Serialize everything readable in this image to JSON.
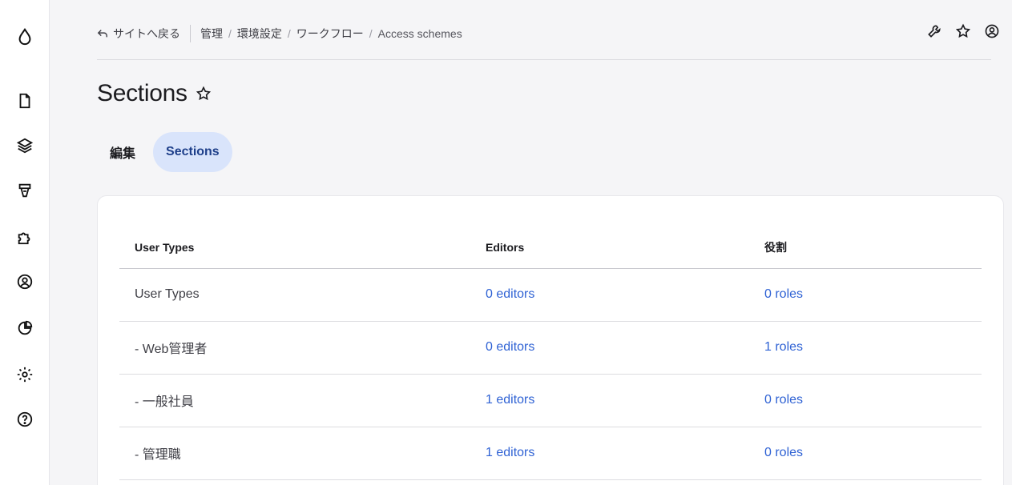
{
  "sidebar": {
    "items": [
      {
        "icon": "drop-logo-icon"
      },
      {
        "icon": "content-icon"
      },
      {
        "icon": "structure-icon"
      },
      {
        "icon": "appearance-icon"
      },
      {
        "icon": "extend-icon"
      },
      {
        "icon": "people-icon"
      },
      {
        "icon": "reports-icon"
      },
      {
        "icon": "configuration-icon"
      },
      {
        "icon": "help-icon"
      }
    ]
  },
  "topbar": {
    "back_label": "サイトへ戻る",
    "breadcrumb": [
      "管理",
      "環境設定",
      "ワークフロー"
    ],
    "current": "Access schemes",
    "actions": [
      "wrench-icon",
      "star-icon",
      "user-icon"
    ]
  },
  "page": {
    "title": "Sections"
  },
  "tabs": [
    {
      "label": "編集",
      "active": false
    },
    {
      "label": "Sections",
      "active": true
    }
  ],
  "table": {
    "headers": [
      "User Types",
      "Editors",
      "役割"
    ],
    "rows": [
      {
        "name": "User Types",
        "editors": "0 editors",
        "roles": "0 roles"
      },
      {
        "name": "- Web管理者",
        "editors": "0 editors",
        "roles": "1 roles"
      },
      {
        "name": "- 一般社員",
        "editors": "1 editors",
        "roles": "0 roles"
      },
      {
        "name": "- 管理職",
        "editors": "1 editors",
        "roles": "0 roles"
      }
    ]
  },
  "colors": {
    "accent": "#2f62d4",
    "tab_active_bg": "#d9e4fb",
    "tab_active_text": "#1e3f8a"
  }
}
